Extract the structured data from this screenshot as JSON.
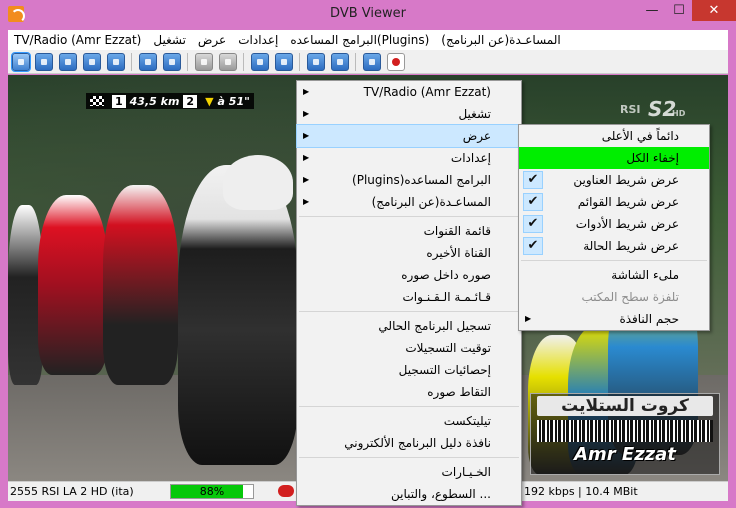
{
  "window": {
    "title": "DVB Viewer",
    "controls": {
      "minimize": "—",
      "maximize": "☐",
      "close": "✕"
    }
  },
  "menubar": {
    "items": [
      "TV/Radio (Amr Ezzat)",
      "تشغيل",
      "عرض",
      "إعدادات",
      "البرامج المساعده(Plugins)",
      "المساعـدة(عن البرنامج)"
    ]
  },
  "toolbar": {
    "buttons": [
      "fullscreen-icon",
      "move-icon",
      "tv-icon",
      "list-icon",
      "epg-icon",
      "prev-channel-icon",
      "next-channel-icon",
      "record-settings-icon",
      "favorites-icon",
      "back-icon",
      "forward-icon",
      "channel-list-icon",
      "tools-icon",
      "info-icon",
      "record-icon"
    ]
  },
  "video": {
    "osd_stage": "1",
    "osd_distance": "43,5 km",
    "osd_stage2": "2",
    "osd_right": "à 51\"",
    "logo_rsi": "RSI",
    "logo_s2": "S2",
    "logo_hd": "HD",
    "watermark_top": "كروت الستلايت",
    "watermark_name": "Amr Ezzat"
  },
  "statusbar": {
    "channel": "2555 RSI LA 2 HD (ita)",
    "progress_percent": 88,
    "progress_text": "88%",
    "bitrate": "192 kbps | 10.4 MBit",
    "accent": "#06c80a"
  },
  "context_menu": {
    "items": [
      {
        "label": "TV/Radio (Amr Ezzat)",
        "submenu": true
      },
      {
        "label": "تشغيل",
        "submenu": true
      },
      {
        "label": "عرض",
        "submenu": true,
        "hover": true
      },
      {
        "label": "إعدادات",
        "submenu": true
      },
      {
        "label": "البرامج المساعده(Plugins)",
        "submenu": true
      },
      {
        "label": "المساعـدة(عن البرنامج)",
        "submenu": true
      },
      {
        "sep": true
      },
      {
        "label": "قائمة القنوات"
      },
      {
        "label": "القناة الأخيره"
      },
      {
        "label": "صوره داخل صوره"
      },
      {
        "label": "قـائـمـة الـقـنـوات"
      },
      {
        "sep": true
      },
      {
        "label": "تسجيل البرنامج الحالي"
      },
      {
        "label": "توقيت التسجيلات"
      },
      {
        "label": "إحصائيات التسجيل"
      },
      {
        "label": "التقاط صوره"
      },
      {
        "sep": true
      },
      {
        "label": "تيليتكست"
      },
      {
        "label": "نافذة دليل البرنامج الألكتروني"
      },
      {
        "sep": true
      },
      {
        "label": "الخـيـارات"
      },
      {
        "label": "... السطوع، والتباين"
      }
    ]
  },
  "view_submenu": {
    "items": [
      {
        "label": "دائماً في الأعلى"
      },
      {
        "label": "إخفاء الكل",
        "green": true
      },
      {
        "label": "عرض شريط العناوين",
        "checked": true
      },
      {
        "label": "عرض شريط القوائم",
        "checked": true
      },
      {
        "label": "عرض شريط الأدوات",
        "checked": true
      },
      {
        "label": "عرض شريط الحالة",
        "checked": true
      },
      {
        "sep": true
      },
      {
        "label": "ملىء الشاشة"
      },
      {
        "label": "تلفزة سطح المكتب",
        "disabled": true
      },
      {
        "label": "حجم النافذة",
        "submenu": true
      }
    ]
  }
}
